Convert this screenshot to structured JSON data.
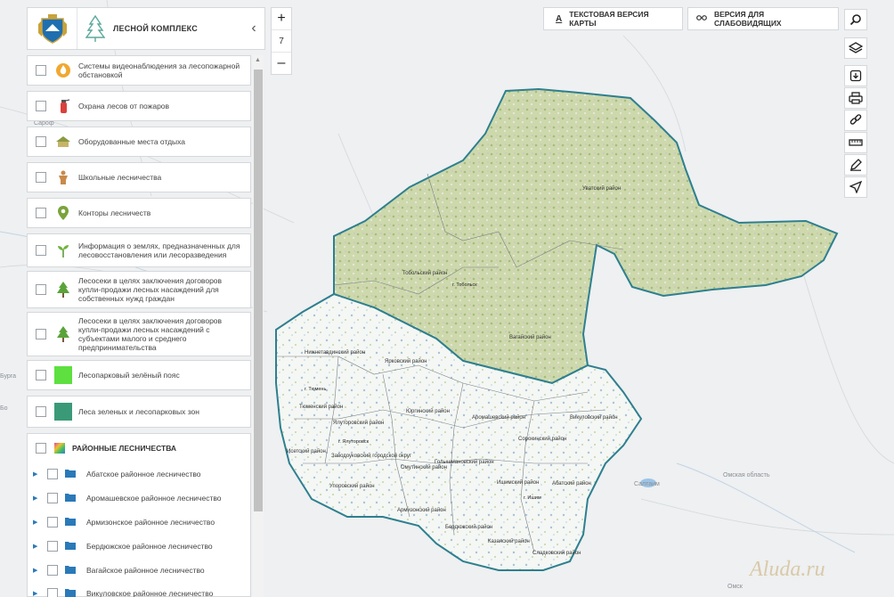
{
  "header": {
    "title": "ЛЕСНОЙ КОМПЛЕКС"
  },
  "zoom": {
    "plus": "+",
    "level": "7",
    "minus": "–"
  },
  "top_buttons": {
    "text_version": "ТЕКСТОВАЯ ВЕРСИЯ КАРТЫ",
    "accessible_version": "ВЕРСИЯ ДЛЯ СЛАБОВИДЯЩИХ"
  },
  "layers": [
    {
      "label": "Системы видеонаблюдения за лесопожарной обстановкой",
      "icon": "fire-camera-icon"
    },
    {
      "label": "Охрана лесов от пожаров",
      "icon": "fire-extinguisher-icon"
    },
    {
      "label": "Оборудованные места отдыха",
      "icon": "rest-area-icon"
    },
    {
      "label": "Школьные лесничества",
      "icon": "school-forestry-icon"
    },
    {
      "label": "Конторы лесничеств",
      "icon": "location-pin-icon"
    },
    {
      "label": "Информация о землях, предназначенных для лесовосстановления или лесоразведения",
      "icon": "seedling-icon"
    },
    {
      "label": "Лесосеки в целях заключения договоров купли-продажи лесных насаждений для собственных нужд граждан",
      "icon": "tree-icon"
    },
    {
      "label": "Лесосеки в целях заключения договоров купли-продажи лесных насаждений с субъектами малого и среднего предпринимательства",
      "icon": "tree-icon"
    },
    {
      "label": "Лесопарковый зелёный пояс",
      "icon": "green-square-icon",
      "color": "#5de040"
    },
    {
      "label": "Леса зеленых и лесопарковых зон",
      "icon": "teal-square-icon",
      "color": "#3a9a78"
    }
  ],
  "forestry_group": {
    "title": "РАЙОННЫЕ ЛЕСНИЧЕСТВА",
    "items": [
      "Абатское районное лесничество",
      "Аромашевское районное лесничество",
      "Армизонское районное лесничество",
      "Бердюжское районное лесничество",
      "Вагайское районное лесничество",
      "Викуловское районное лесничество"
    ]
  },
  "map": {
    "districts": [
      "Уватский район",
      "Тобольский район",
      "г. Тобольск",
      "Вагайский район",
      "Нижнетавдинский район",
      "Ярковский район",
      "Тюменский район",
      "г. Тюмень",
      "Ялуторовский район",
      "г. Ялуторовск",
      "Юргинский район",
      "Аромашевский район",
      "Викуловский район",
      "Сорокинский район",
      "Исетский район",
      "Заводоуковский городской округ",
      "Омутинский район",
      "Голышмановский район",
      "Ишимский район",
      "г. Ишим",
      "Абатский район",
      "Упоровский район",
      "Армизонский район",
      "Бердюжский район",
      "Казанский район",
      "Сладковский район"
    ],
    "background_labels": [
      "Сароф",
      "Омская область",
      "Салтаим",
      "Омск",
      "Бурга",
      "Бо"
    ]
  },
  "watermark": "Aluda.ru",
  "colors": {
    "region_border": "#2e7f8f",
    "forest": "#c9d6a8",
    "accent": "#2a79b8"
  }
}
